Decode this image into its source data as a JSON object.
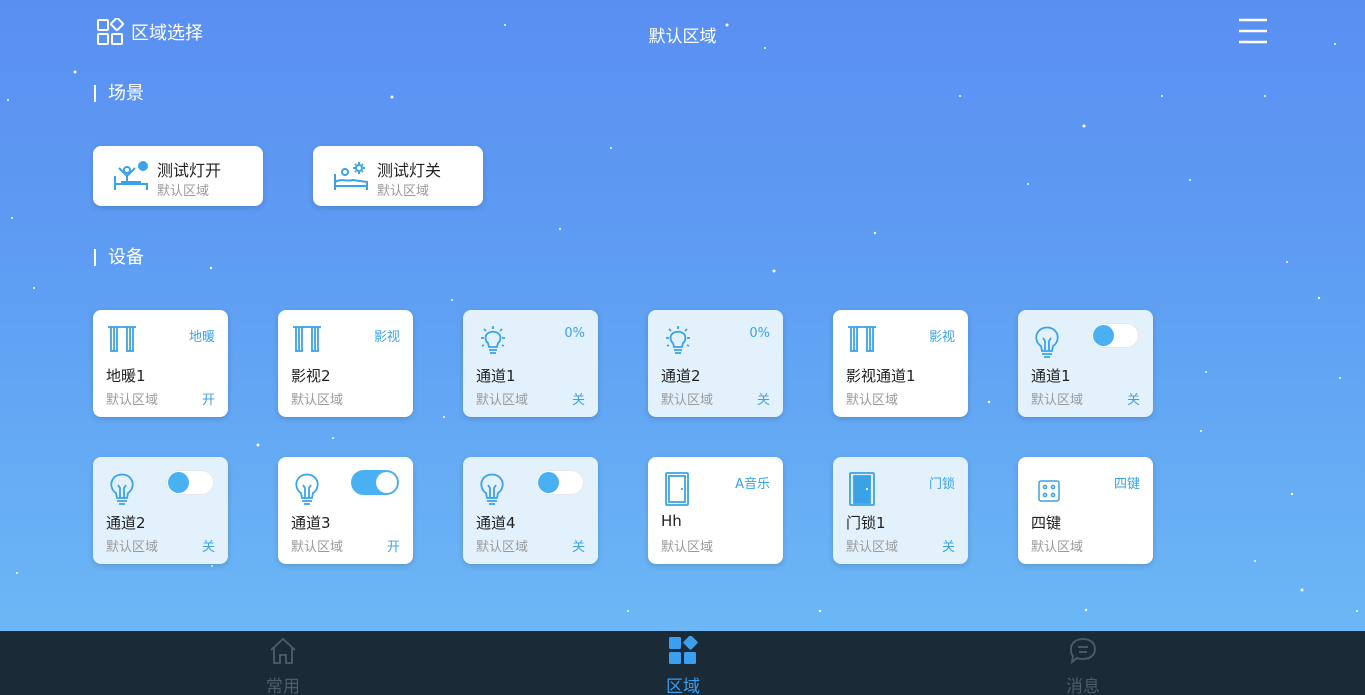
{
  "header": {
    "area_select_label": "区域选择",
    "title": "默认区域"
  },
  "sections": {
    "scenes_title": "场景",
    "devices_title": "设备"
  },
  "scenes": [
    {
      "name": "测试灯开",
      "area": "默认区域",
      "icon": "person-bed-light-on-icon"
    },
    {
      "name": "测试灯关",
      "area": "默认区域",
      "icon": "person-bed-light-off-icon"
    }
  ],
  "devices": [
    {
      "name": "地暖1",
      "area": "默认区域",
      "type": "地暖",
      "state": "开",
      "icon": "curtain-icon"
    },
    {
      "name": "影视2",
      "area": "默认区域",
      "type": "影视",
      "state": "",
      "icon": "curtain-icon"
    },
    {
      "name": "通道1",
      "area": "默认区域",
      "type": "0%",
      "state": "关",
      "icon": "bulb-glow-icon"
    },
    {
      "name": "通道2",
      "area": "默认区域",
      "type": "0%",
      "state": "关",
      "icon": "bulb-glow-icon"
    },
    {
      "name": "影视通道1",
      "area": "默认区域",
      "type": "影视",
      "state": "",
      "icon": "curtain-icon"
    },
    {
      "name": "通道1",
      "area": "默认区域",
      "state": "关",
      "icon": "bulb-icon",
      "toggle_on": false
    },
    {
      "name": "通道2",
      "area": "默认区域",
      "state": "关",
      "icon": "bulb-icon",
      "toggle_on": false
    },
    {
      "name": "通道3",
      "area": "默认区域",
      "state": "开",
      "icon": "bulb-icon",
      "toggle_on": true
    },
    {
      "name": "通道4",
      "area": "默认区域",
      "state": "关",
      "icon": "bulb-icon",
      "toggle_on": false
    },
    {
      "name": "Hh",
      "area": "默认区域",
      "type": "A音乐",
      "state": "",
      "icon": "door-icon"
    },
    {
      "name": "门锁1",
      "area": "默认区域",
      "type": "门锁",
      "state": "关",
      "icon": "door-lock-icon"
    },
    {
      "name": "四键",
      "area": "默认区域",
      "type": "四键",
      "state": "",
      "icon": "four-key-switch-icon"
    }
  ],
  "bottom_nav": [
    {
      "label": "常用",
      "icon": "home-icon",
      "active": false
    },
    {
      "label": "区域",
      "icon": "area-grid-icon",
      "active": true
    },
    {
      "label": "消息",
      "icon": "message-icon",
      "active": false
    }
  ],
  "colors": {
    "accent": "#3aa3e8",
    "nav_active": "#3a9ff0",
    "nav_bg": "#1b2a37",
    "tinted_card": "#e3f1fc"
  }
}
